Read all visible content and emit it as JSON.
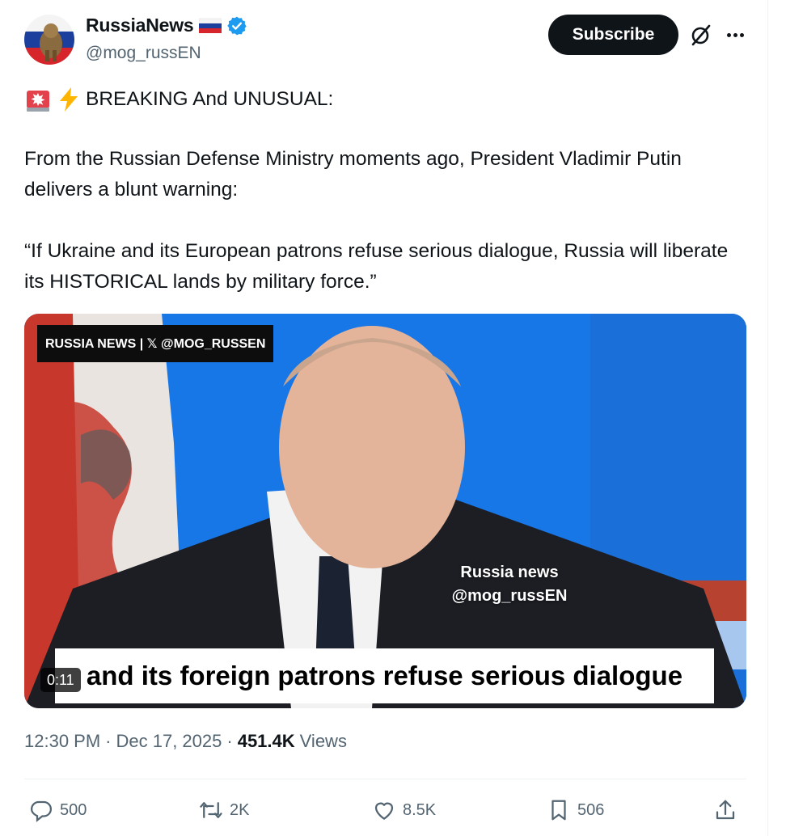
{
  "author": {
    "display_name": "RussiaNews",
    "handle": "@mog_russEN",
    "flag_icon": "russia-flag-icon",
    "verified_color": "#1d9bf0"
  },
  "header": {
    "subscribe_label": "Subscribe"
  },
  "body": {
    "line1": "BREAKING And UNUSUAL:",
    "line2": "From the Russian Defense Ministry moments ago, President Vladimir Putin delivers a blunt warning:",
    "line3": "“If Ukraine and its European patrons refuse serious dialogue, Russia will liberate its HISTORICAL lands by military force.”"
  },
  "video": {
    "brand_overlay": "RUSSIA NEWS | 𝕏 @MOG_RUSSEN",
    "watermark_line1": "Russia news",
    "watermark_line2": "@mog_russEN",
    "caption": "and its foreign patrons refuse serious dialogue",
    "timestamp": "0:11"
  },
  "meta": {
    "time": "12:30 PM",
    "date": "Dec 17, 2025",
    "views_count": "451.4K",
    "views_label": "Views"
  },
  "actions": {
    "replies": "500",
    "reposts": "2K",
    "likes": "8.5K",
    "bookmarks": "506"
  },
  "colors": {
    "text_primary": "#0f1419",
    "text_secondary": "#536471",
    "accent": "#1d9bf0",
    "video_background": "#1877e6"
  }
}
